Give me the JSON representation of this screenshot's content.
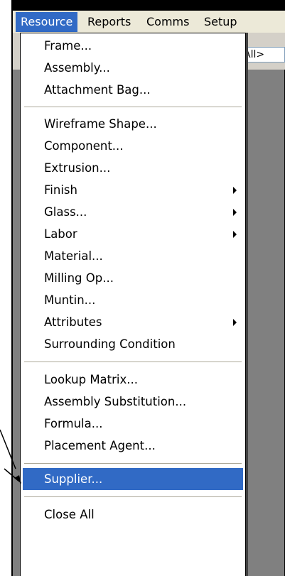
{
  "menubar": {
    "items": [
      {
        "label": "Resource",
        "active": true
      },
      {
        "label": "Reports",
        "active": false
      },
      {
        "label": "Comms",
        "active": false
      },
      {
        "label": "Setup",
        "active": false
      }
    ]
  },
  "filter_combo": {
    "value": "All>"
  },
  "resource_menu": {
    "items": [
      {
        "label": "Frame...",
        "submenu": false
      },
      {
        "label": "Assembly...",
        "submenu": false
      },
      {
        "label": "Attachment Bag...",
        "submenu": false
      },
      {
        "label": "Wireframe Shape...",
        "submenu": false
      },
      {
        "label": "Component...",
        "submenu": false
      },
      {
        "label": "Extrusion...",
        "submenu": false
      },
      {
        "label": "Finish",
        "submenu": true
      },
      {
        "label": "Glass...",
        "submenu": true
      },
      {
        "label": "Labor",
        "submenu": true
      },
      {
        "label": "Material...",
        "submenu": false
      },
      {
        "label": "Milling Op...",
        "submenu": false
      },
      {
        "label": "Muntin...",
        "submenu": false
      },
      {
        "label": "Attributes",
        "submenu": true
      },
      {
        "label": "Surrounding Condition",
        "submenu": false
      },
      {
        "label": "Lookup Matrix...",
        "submenu": false
      },
      {
        "label": "Assembly Substitution...",
        "submenu": false
      },
      {
        "label": "Formula...",
        "submenu": false
      },
      {
        "label": "Placement Agent...",
        "submenu": false
      },
      {
        "label": "Supplier...",
        "submenu": false,
        "highlighted": true
      },
      {
        "label": "Close All",
        "submenu": false
      }
    ]
  },
  "colors": {
    "highlight": "#316ac5",
    "menubar_bg": "#ece9d8",
    "workspace_bg": "#808080"
  }
}
